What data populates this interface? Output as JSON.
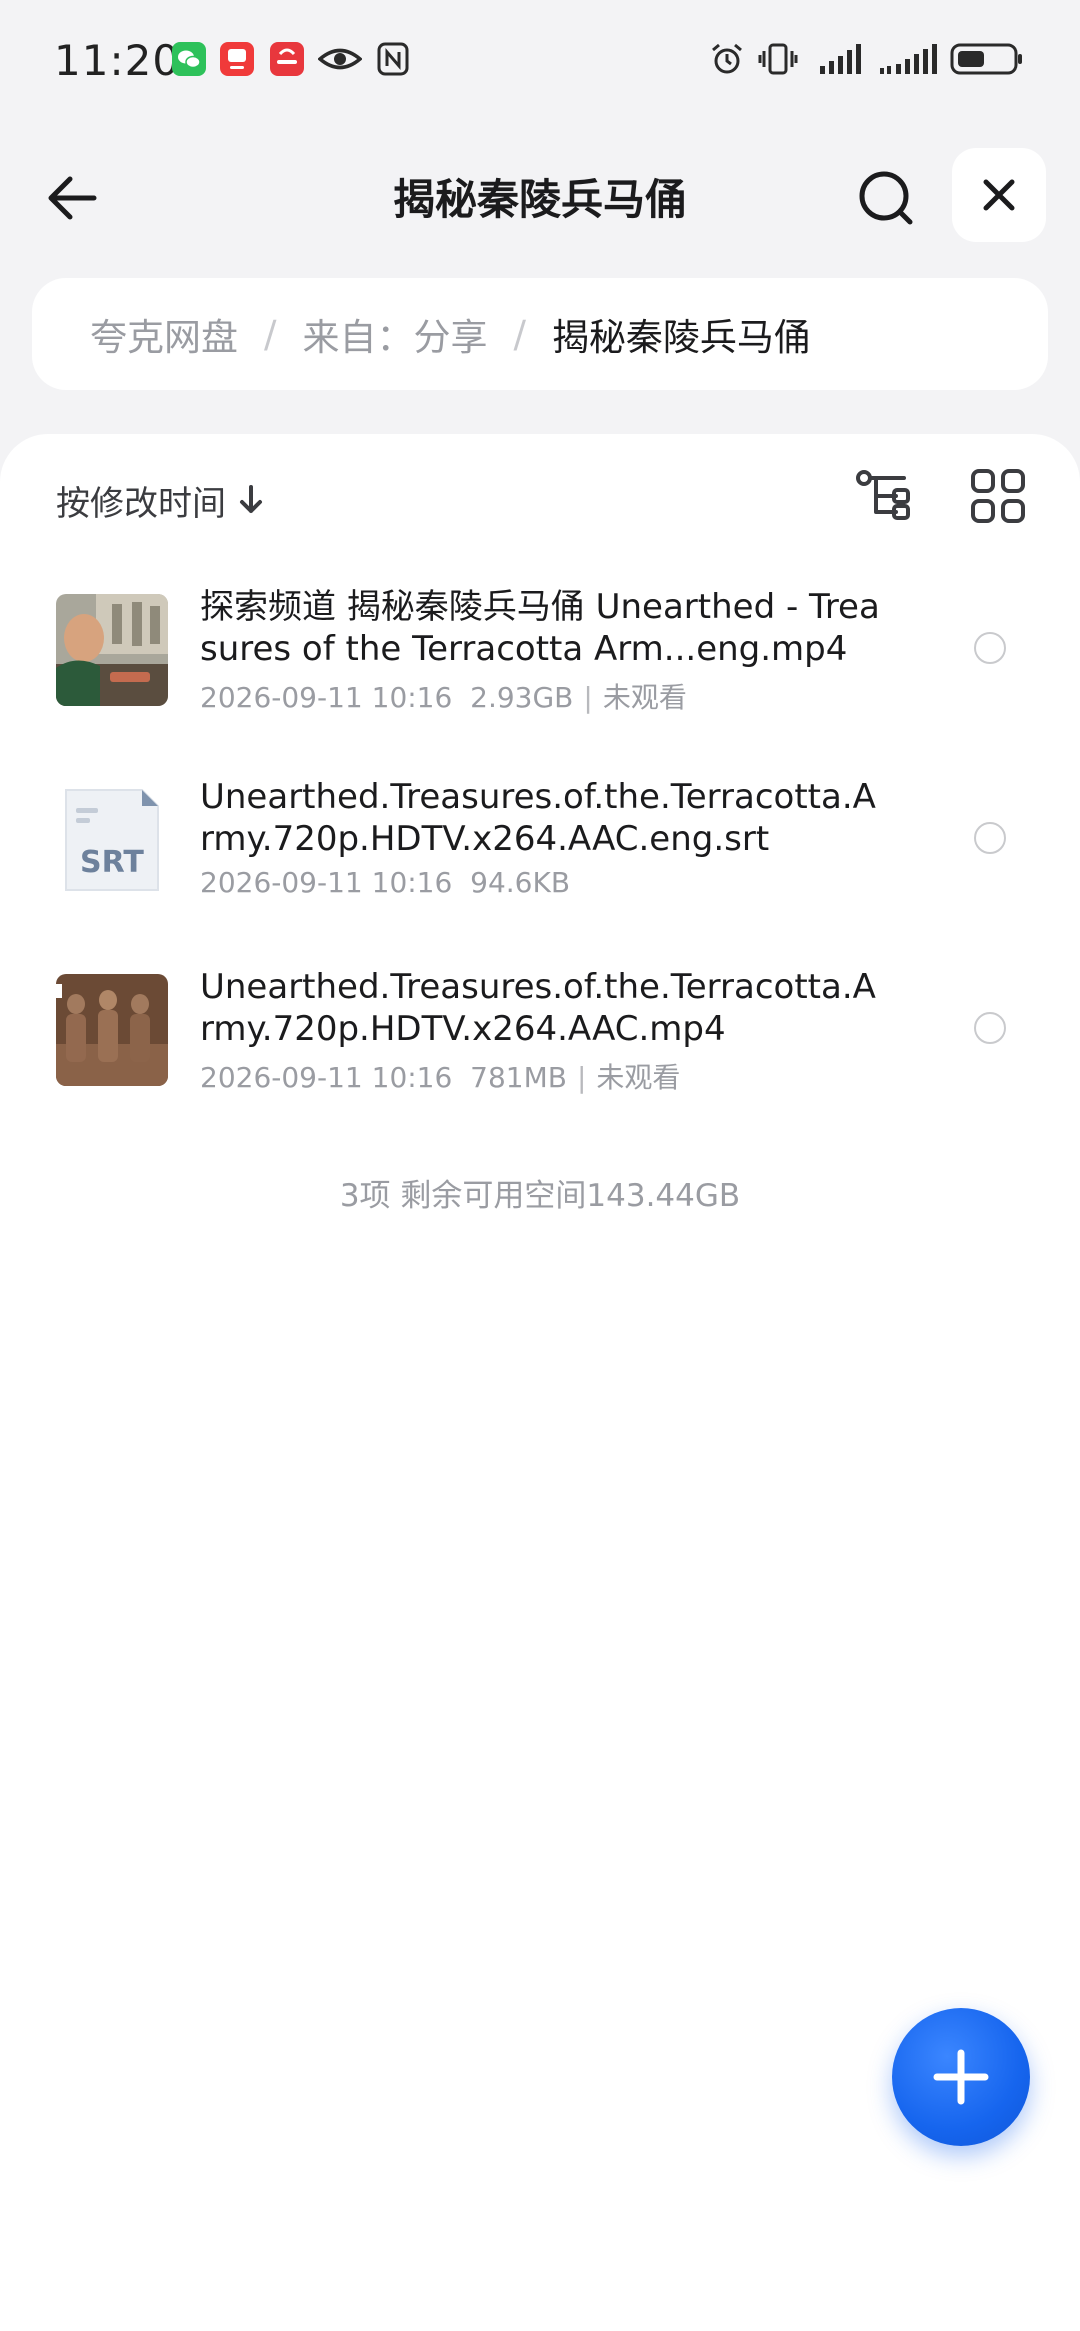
{
  "status_bar": {
    "time": "11:20",
    "app_icons": [
      "wechat-icon",
      "app-red-icon",
      "huawei-icon",
      "eye-icon",
      "nfc-icon"
    ],
    "system_icons": [
      "alarm-icon",
      "vibrate-icon",
      "signal-icon",
      "signal-icon-2",
      "battery-icon"
    ]
  },
  "header": {
    "title": "揭秘秦陵兵马俑"
  },
  "breadcrumb": {
    "items": [
      "夸克网盘",
      "来自：分享",
      "揭秘秦陵兵马俑"
    ],
    "separator": "/"
  },
  "toolbar": {
    "sort_label": "按修改时间"
  },
  "files": [
    {
      "name": "探索频道 揭秘秦陵兵马俑 Unearthed - Treasures of the Terracotta Arm...eng.mp4",
      "date": "2026-09-11 10:16",
      "size": "2.93GB",
      "status": "未观看",
      "type": "video"
    },
    {
      "name": "Unearthed.Treasures.of.the.Terracotta.Army.720p.HDTV.x264.AAC.eng.srt",
      "date": "2026-09-11 10:16",
      "size": "94.6KB",
      "status": "",
      "type": "srt",
      "thumb_label": "SRT"
    },
    {
      "name": "Unearthed.Treasures.of.the.Terracotta.Army.720p.HDTV.x264.AAC.mp4",
      "date": "2026-09-11 10:16",
      "size": "781MB",
      "status": "未观看",
      "type": "video"
    }
  ],
  "summary": "3项 剩余可用空间143.44GB",
  "colors": {
    "accent": "#1665ee",
    "background": "#f3f3f5",
    "muted_text": "#9a9ca2"
  }
}
